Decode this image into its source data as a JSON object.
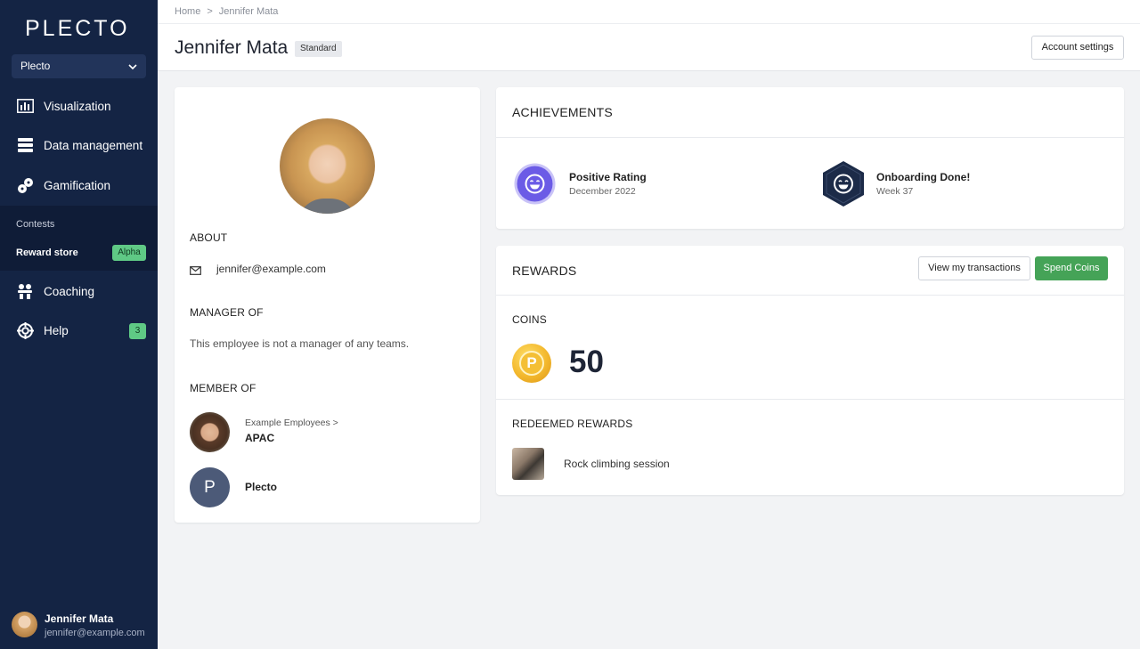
{
  "sidebar": {
    "logo": "PLECTO",
    "org_select": "Plecto",
    "nav": [
      {
        "label": "Visualization",
        "icon": "bar-chart-icon"
      },
      {
        "label": "Data management",
        "icon": "database-icon"
      },
      {
        "label": "Gamification",
        "icon": "gamepad-icon"
      },
      {
        "label": "Coaching",
        "icon": "coaching-icon"
      },
      {
        "label": "Help",
        "icon": "lifebuoy-icon",
        "badge": "3"
      }
    ],
    "subnav": [
      {
        "label": "Contests"
      },
      {
        "label": "Reward store",
        "badge": "Alpha"
      }
    ],
    "user": {
      "name": "Jennifer Mata",
      "email": "jennifer@example.com"
    }
  },
  "header": {
    "breadcrumb": [
      "Home",
      "Jennifer Mata"
    ],
    "title": "Jennifer Mata",
    "tier_badge": "Standard",
    "account_settings": "Account settings"
  },
  "profile": {
    "about_heading": "ABOUT",
    "email": "jennifer@example.com",
    "manager_heading": "MANAGER OF",
    "manager_text": "This employee is not a manager of any teams.",
    "member_heading": "MEMBER OF",
    "teams": [
      {
        "parent": "Example Employees >",
        "name": "APAC"
      },
      {
        "letter": "P",
        "name": "Plecto"
      }
    ]
  },
  "achievements": {
    "title": "ACHIEVEMENTS",
    "items": [
      {
        "name": "Positive Rating",
        "sub": "December 2022",
        "color": "#6b5be6"
      },
      {
        "name": "Onboarding Done!",
        "sub": "Week 37",
        "color": "#1c2b48"
      }
    ]
  },
  "rewards": {
    "title": "REWARDS",
    "view_transactions": "View my transactions",
    "spend_coins": "Spend Coins",
    "coins_heading": "COINS",
    "coin_letter": "P",
    "coins_value": "50",
    "redeemed_heading": "REDEEMED REWARDS",
    "redeemed": [
      {
        "name": "Rock climbing session"
      }
    ]
  },
  "colors": {
    "sidebar": "#142444",
    "accent_green": "#45a357",
    "badge_green": "#5fc985"
  }
}
